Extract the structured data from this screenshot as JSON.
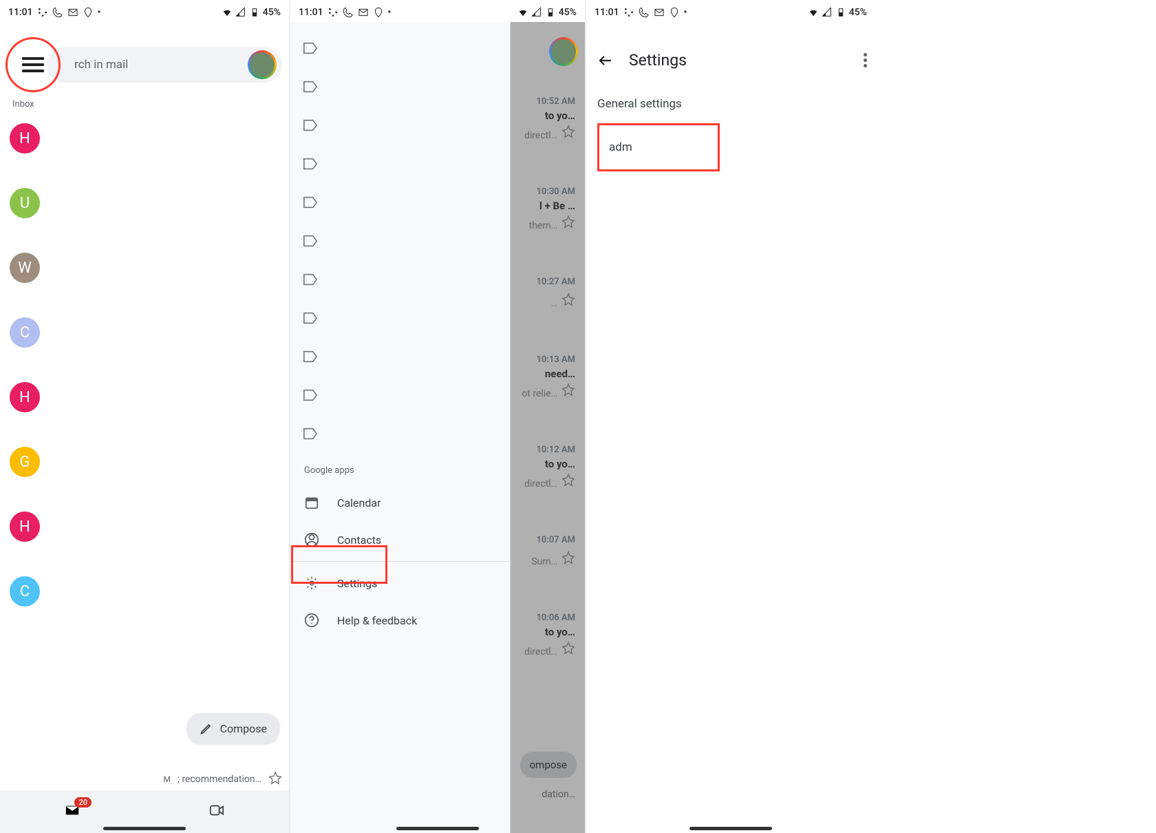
{
  "status_bar": {
    "time": "11:01",
    "battery_pct": "45%"
  },
  "panel1": {
    "search_placeholder": "rch in mail",
    "inbox_label": "Inbox",
    "senders": [
      {
        "letter": "H",
        "color": "#e91e63"
      },
      {
        "letter": "U",
        "color": "#8bc34a"
      },
      {
        "letter": "W",
        "color": "#9e8c7d"
      },
      {
        "letter": "C",
        "color": "#b0bef0"
      },
      {
        "letter": "H",
        "color": "#e91e63"
      },
      {
        "letter": "G",
        "color": "#fbbc04"
      },
      {
        "letter": "H",
        "color": "#e91e63"
      },
      {
        "letter": "C",
        "color": "#4fc3f7"
      }
    ],
    "compose_label": "Compose",
    "rec_text": "; recommendation…",
    "rec_m": "M",
    "badge_count": "20"
  },
  "panel2": {
    "section_title": "Google apps",
    "apps": {
      "calendar": "Calendar",
      "contacts": "Contacts"
    },
    "settings_label": "Settings",
    "help_label": "Help & feedback",
    "rows": [
      {
        "time": "10:52 AM",
        "subj": "to yo…",
        "snip": "directl…"
      },
      {
        "time": "10:30 AM",
        "subj": "l + Be …",
        "snip": "them…"
      },
      {
        "time": "10:27 AM",
        "subj": "",
        "snip": "…"
      },
      {
        "time": "10:13 AM",
        "subj": "need…",
        "snip": "ot relie…"
      },
      {
        "time": "10:12 AM",
        "subj": "to yo…",
        "snip": "directl…"
      },
      {
        "time": "10:07 AM",
        "subj": "",
        "snip": "Sum…"
      },
      {
        "time": "10:06 AM",
        "subj": "to yo…",
        "snip": "directl…"
      }
    ],
    "compose_label": "ompose",
    "rec_text": "dation…"
  },
  "panel3": {
    "title": "Settings",
    "general": "General settings",
    "account_partial": "adm"
  }
}
